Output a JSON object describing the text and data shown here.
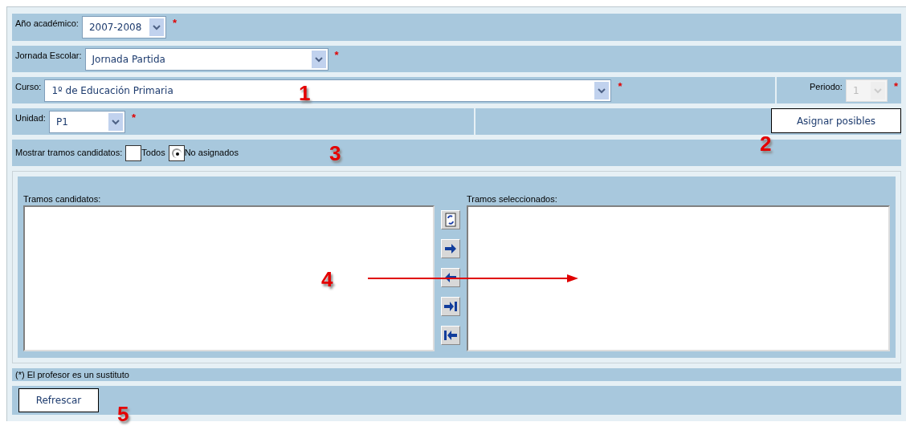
{
  "form": {
    "year": {
      "label": "Año académico:",
      "value": "2007-2008",
      "required": true
    },
    "schedule": {
      "label": "Jornada Escolar:",
      "value": "Jornada Partida",
      "required": true
    },
    "course": {
      "label": "Curso:",
      "value": "1º de Educación Primaria",
      "required": true
    },
    "period": {
      "label": "Periodo:",
      "value": "1",
      "required": true,
      "disabled": true
    },
    "unit": {
      "label": "Unidad:",
      "value": "P1",
      "required": true
    },
    "assign_button": "Asignar posibles",
    "show_filter": {
      "label": "Mostrar tramos candidatos:",
      "options": [
        {
          "label": "Todos",
          "selected": false
        },
        {
          "label": "No asignados",
          "selected": true
        }
      ]
    }
  },
  "candidates": {
    "label": "Tramos candidatos:"
  },
  "selected": {
    "label": "Tramos seleccionados:"
  },
  "transfer_buttons": [
    {
      "kind": "refresh"
    },
    {
      "kind": "right"
    },
    {
      "kind": "left"
    },
    {
      "kind": "all-right"
    },
    {
      "kind": "all-left"
    }
  ],
  "required_mark": "*",
  "footnote": "(*) El profesor es un sustituto",
  "refresh_button": "Refrescar",
  "annotations": [
    "1",
    "2",
    "3",
    "4",
    "5"
  ]
}
